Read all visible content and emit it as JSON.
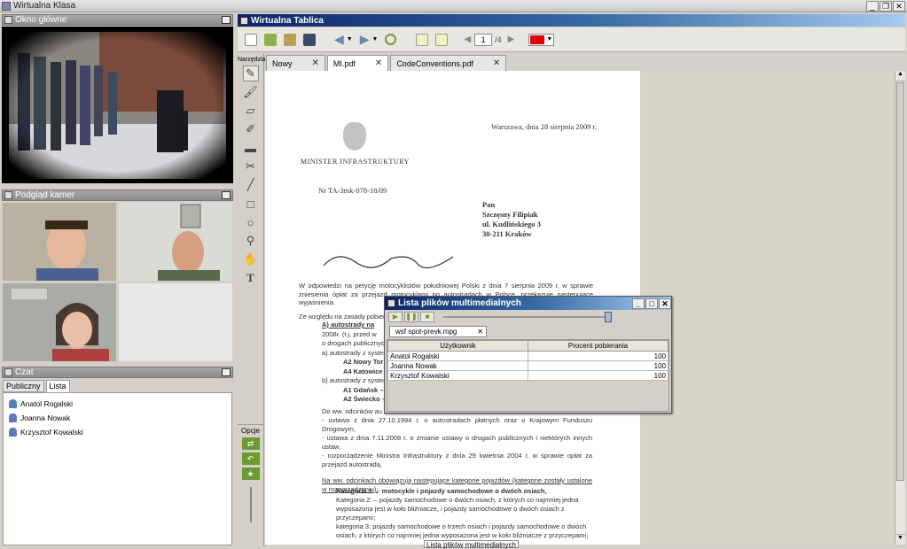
{
  "app": {
    "title": "Wirtualna Klasa"
  },
  "panels": {
    "main_window": "Okno główne",
    "cameras": "Podgląd kamer",
    "chat": "Czat",
    "whiteboard": "Wirtualna Tablica"
  },
  "chat": {
    "tabs": [
      "Publiczny",
      "Lista"
    ],
    "users": [
      "Anatol Rogalski",
      "Joanna Nowak",
      "Krzysztof Kowalski"
    ]
  },
  "toolbar": {
    "page_current": "1",
    "page_total": "/4",
    "color": "#e00000"
  },
  "tools_label": "Narzędzia",
  "options_label": "Opcje",
  "doc_tabs": [
    "Nowy",
    "MI.pdf",
    "CodeConventions.pdf"
  ],
  "document": {
    "date": "Warszawa, dnia 28 sierpnia 2009 r.",
    "ministry": "MINISTER INFRASTRUKTURY",
    "ref": "Nr TA-3mk-078-18/09",
    "addr": [
      "Pan",
      "Szczęsny Filipiak",
      "ul. Kudlińskiego 3",
      "30-211 Kraków"
    ],
    "body1": "W odpowiedzi na petycję motocyklistów południowej Polski z dnia 7 sierpnia 2009 r. w sprawie zniesienia opłat za przejazd motocyklami po autostradach w Polsce, przekazuję następujące wyjaśnienia.",
    "body2": "Ze względu na zasady pobiera",
    "l1": "A) autostrady na",
    "l2": "2008r. (t.j. przed w",
    "l3": "o drogach publicznyc",
    "l4": "a) autostrady z syster",
    "l5": "A2 Nowy Tor",
    "l6": "A4 Katowice",
    "l7": "b) autostrady z syster",
    "l8": "A1 Gdańsk –",
    "l9": "A2 Świecko –",
    "b3": "Do ww. odcinków au",
    "b4": "- ustawa z dnia 27.10.1994 r. o autostradach płatnych oraz o Krajowym Funduszu Drogowym,",
    "b5": "- ustawa z dnia 7.11.2008 r. o zmianie ustawy o drogach publicznych i niektórych innych ustaw,",
    "b6": "- rozporządzenie Ministra Infrastruktury z dnia 29 kwietnia 2004 r. w sprawie opłat za przejazd autostradą.",
    "b7": "Na ww. odcinkach obowiązują następujące kategorie pojazdów (kategorie zostały ustalone w rozporządzeniu):",
    "k1": "Kategoria 1: – motocykle i pojazdy samochodowe o dwóch osiach,",
    "k2": "Kategoria 2: – pojazdy samochodowe o dwóch osiach, z których co najmniej jedna wyposażona jest w koło bliźniacze, i pojazdy samochodowe o dwóch osiach z przyczepami;",
    "k3": "kategoria 3: pojazdy samochodowe o trzech osiach i pojazdy samochodowe o dwóch osiach, z których co najmniej jedna wyposażona jest w koło bliźniacze z przyczepami;"
  },
  "media": {
    "title": "Lista plików multimedialnych",
    "file_tab": "wsf spot-prevk.mpg",
    "columns": [
      "Użytkownik",
      "Procent pobierania"
    ],
    "rows": [
      [
        "Anatol Rogalski",
        "100"
      ],
      [
        "Joanna Nowak",
        "100"
      ],
      [
        "Krzysztof Kowalski",
        "100"
      ]
    ],
    "taskbar_label": "Lista plików multimedialnych"
  }
}
